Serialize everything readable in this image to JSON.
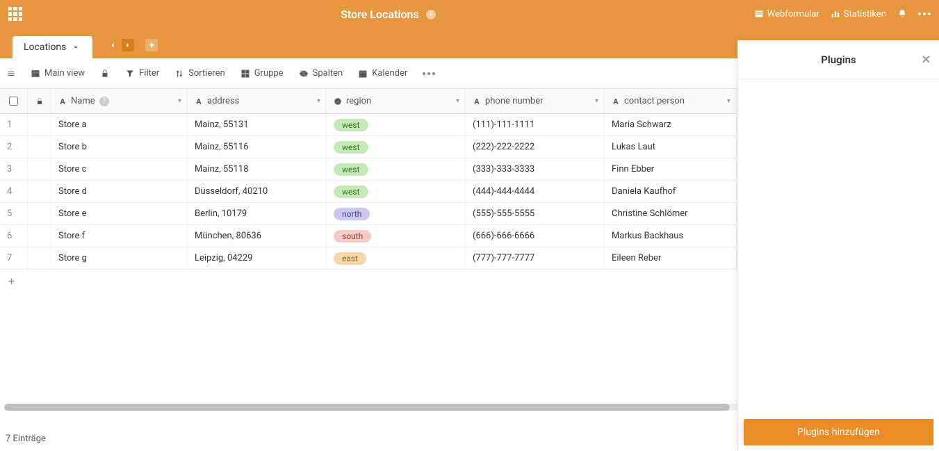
{
  "header": {
    "title": "Store Locations",
    "links": {
      "webform": "Webformular",
      "stats": "Statistiken",
      "plugins": "Plugins"
    }
  },
  "tabs": {
    "active": "Locations"
  },
  "toolbar": {
    "main_view": "Main view",
    "filter": "Filter",
    "sort": "Sortieren",
    "group": "Gruppe",
    "columns": "Spalten",
    "calendar": "Kalender"
  },
  "columns": {
    "name": "Name",
    "address": "address",
    "region": "region",
    "phone": "phone number",
    "contact": "contact person"
  },
  "rows": [
    {
      "n": "1",
      "name": "Store a",
      "address": "Mainz, 55131",
      "region": "west",
      "region_class": "tag-west",
      "phone": "(111)-111-1111",
      "contact": "Maria Schwarz"
    },
    {
      "n": "2",
      "name": "Store b",
      "address": "Mainz, 55116",
      "region": "west",
      "region_class": "tag-west",
      "phone": "(222)-222-2222",
      "contact": "Lukas Laut"
    },
    {
      "n": "3",
      "name": "Store c",
      "address": "Mainz, 55118",
      "region": "west",
      "region_class": "tag-west",
      "phone": "(333)-333-3333",
      "contact": "Finn Ebber"
    },
    {
      "n": "4",
      "name": "Store d",
      "address": "Düsseldorf, 40210",
      "region": "west",
      "region_class": "tag-west",
      "phone": "(444)-444-4444",
      "contact": "Daniela Kaufhof"
    },
    {
      "n": "5",
      "name": "Store e",
      "address": "Berlin, 10179",
      "region": "north",
      "region_class": "tag-north",
      "phone": "(555)-555-5555",
      "contact": "Christine Schlömer"
    },
    {
      "n": "6",
      "name": "Store f",
      "address": "München, 80636",
      "region": "south",
      "region_class": "tag-south",
      "phone": "(666)-666-6666",
      "contact": "Markus Backhaus"
    },
    {
      "n": "7",
      "name": "Store g",
      "address": "Leipzig, 04229",
      "region": "east",
      "region_class": "tag-east",
      "phone": "(777)-777-7777",
      "contact": "Eileen Reber"
    }
  ],
  "status": {
    "entries": "7 Einträge"
  },
  "panel": {
    "title": "Plugins",
    "add_button": "Plugins hinzufügen"
  }
}
